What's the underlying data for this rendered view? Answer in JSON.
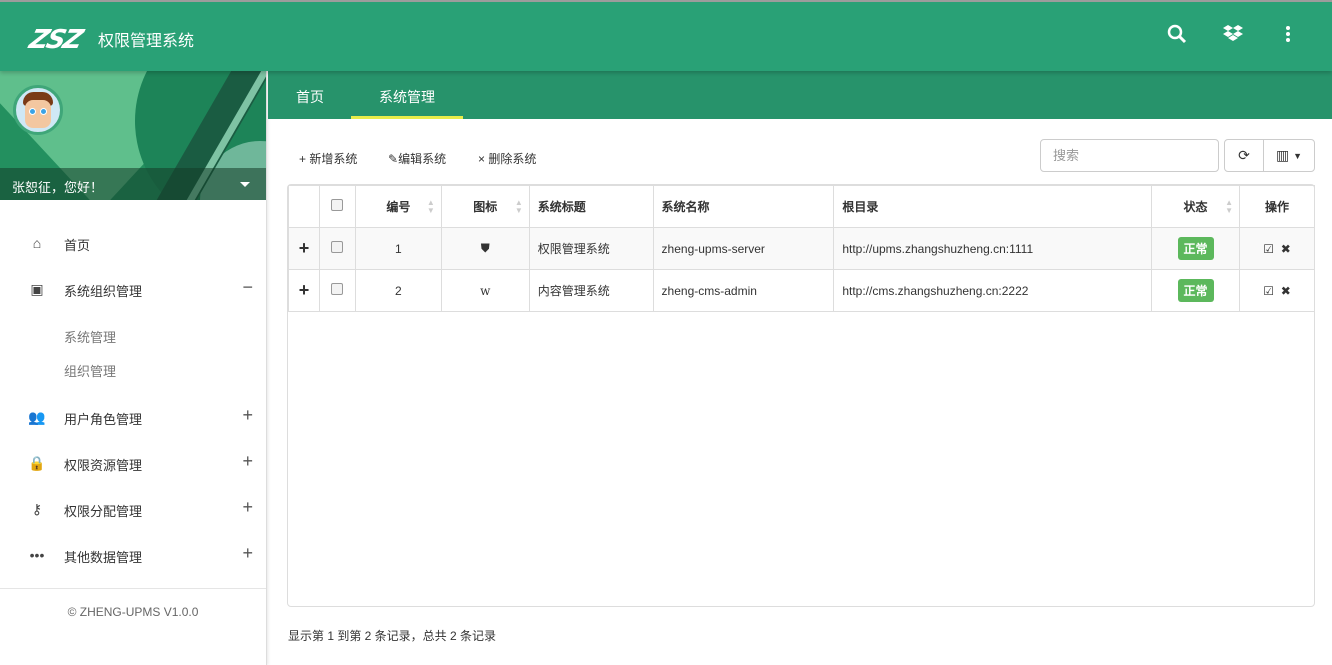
{
  "header": {
    "logo": "ZSZ",
    "title": "权限管理系统",
    "icons": [
      "search-icon",
      "dropbox-icon",
      "more-vert-icon"
    ]
  },
  "colors": {
    "primary": "#29a176",
    "tabbar": "#27936b",
    "tab_indicator": "#e8ec4a",
    "badge": "#5cb85c"
  },
  "sidebar": {
    "greeting": "张恕征，您好！",
    "items": [
      {
        "label": "首页",
        "icon": "home-icon"
      },
      {
        "label": "系统组织管理",
        "icon": "id-card-icon",
        "toggle": "−",
        "children": [
          "系统管理",
          "组织管理"
        ]
      },
      {
        "label": "用户角色管理",
        "icon": "users-icon",
        "toggle": "+"
      },
      {
        "label": "权限资源管理",
        "icon": "lock-icon",
        "toggle": "+"
      },
      {
        "label": "权限分配管理",
        "icon": "key-icon",
        "toggle": "+"
      },
      {
        "label": "其他数据管理",
        "icon": "more-horiz-icon",
        "toggle": "+"
      }
    ],
    "footer": "© ZHENG-UPMS V1.0.0"
  },
  "tabs": [
    {
      "label": "首页"
    },
    {
      "label": "系统管理",
      "active": true
    }
  ],
  "toolbar": {
    "add": "+ 新增系统",
    "edit": "编辑系统",
    "delete": "× 删除系统",
    "search_placeholder": "搜索"
  },
  "table": {
    "columns": [
      "",
      "",
      "编号",
      "图标",
      "系统标题",
      "系统名称",
      "根目录",
      "状态",
      "操作"
    ],
    "rows": [
      {
        "id": "1",
        "icon": "shield-icon",
        "title": "权限管理系统",
        "name": "zheng-upms-server",
        "basepath": "http://upms.zhangshuzheng.cn:1111",
        "status": "正常"
      },
      {
        "id": "2",
        "icon": "w-icon",
        "title": "内容管理系统",
        "name": "zheng-cms-admin",
        "basepath": "http://cms.zhangshuzheng.cn:2222",
        "status": "正常"
      }
    ]
  },
  "pagination": {
    "info": "显示第 1 到第 2 条记录，总共 2 条记录"
  }
}
